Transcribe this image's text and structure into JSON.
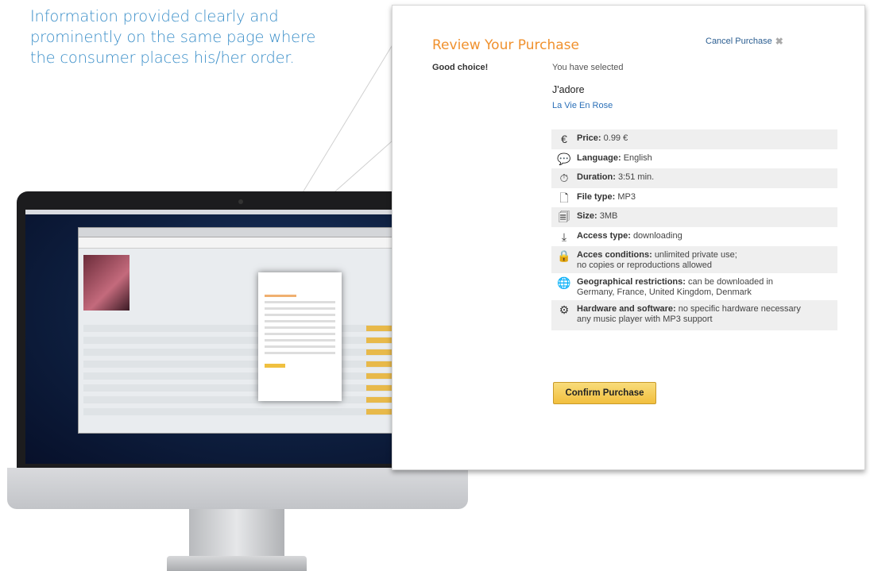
{
  "caption": "Information provided clearly and prominently on the same page where the consumer places his/her order.",
  "dialog": {
    "title": "Review Your Purchase",
    "cancel_label": "Cancel Purchase",
    "good_choice": "Good choice!",
    "selected_label": "You have selected",
    "song_title": "J'adore",
    "album_link": "La Vie En Rose",
    "confirm_label": "Confirm Purchase"
  },
  "info": [
    {
      "icon": "euro-icon",
      "glyph": "€",
      "label": "Price:",
      "value": "0.99 €",
      "value2": ""
    },
    {
      "icon": "speech-bubble-icon",
      "glyph": "💬",
      "label": "Language:",
      "value": "English",
      "value2": ""
    },
    {
      "icon": "stopwatch-icon",
      "glyph": "⏱",
      "label": "Duration:",
      "value": "3:51 min.",
      "value2": ""
    },
    {
      "icon": "file-icon",
      "glyph": "🗋",
      "label": "File type:",
      "value": "MP3",
      "value2": ""
    },
    {
      "icon": "file-size-icon",
      "glyph": "🗐",
      "label": "Size:",
      "value": "3MB",
      "value2": ""
    },
    {
      "icon": "download-icon",
      "glyph": "⤓",
      "label": "Access type:",
      "value": "downloading",
      "value2": ""
    },
    {
      "icon": "lock-icon",
      "glyph": "🔒",
      "label": "Acces conditions:",
      "value": "unlimited private use;",
      "value2": "no copies or reproductions allowed"
    },
    {
      "icon": "globe-icon",
      "glyph": "🌐",
      "label": "Geographical restrictions:",
      "value": "can be downloaded in",
      "value2": "Germany, France, United Kingdom, Denmark"
    },
    {
      "icon": "gears-icon",
      "glyph": "⚙",
      "label": "Hardware and software:",
      "value": "no specific hardware necessary",
      "value2": "any music player with MP3 support"
    }
  ]
}
